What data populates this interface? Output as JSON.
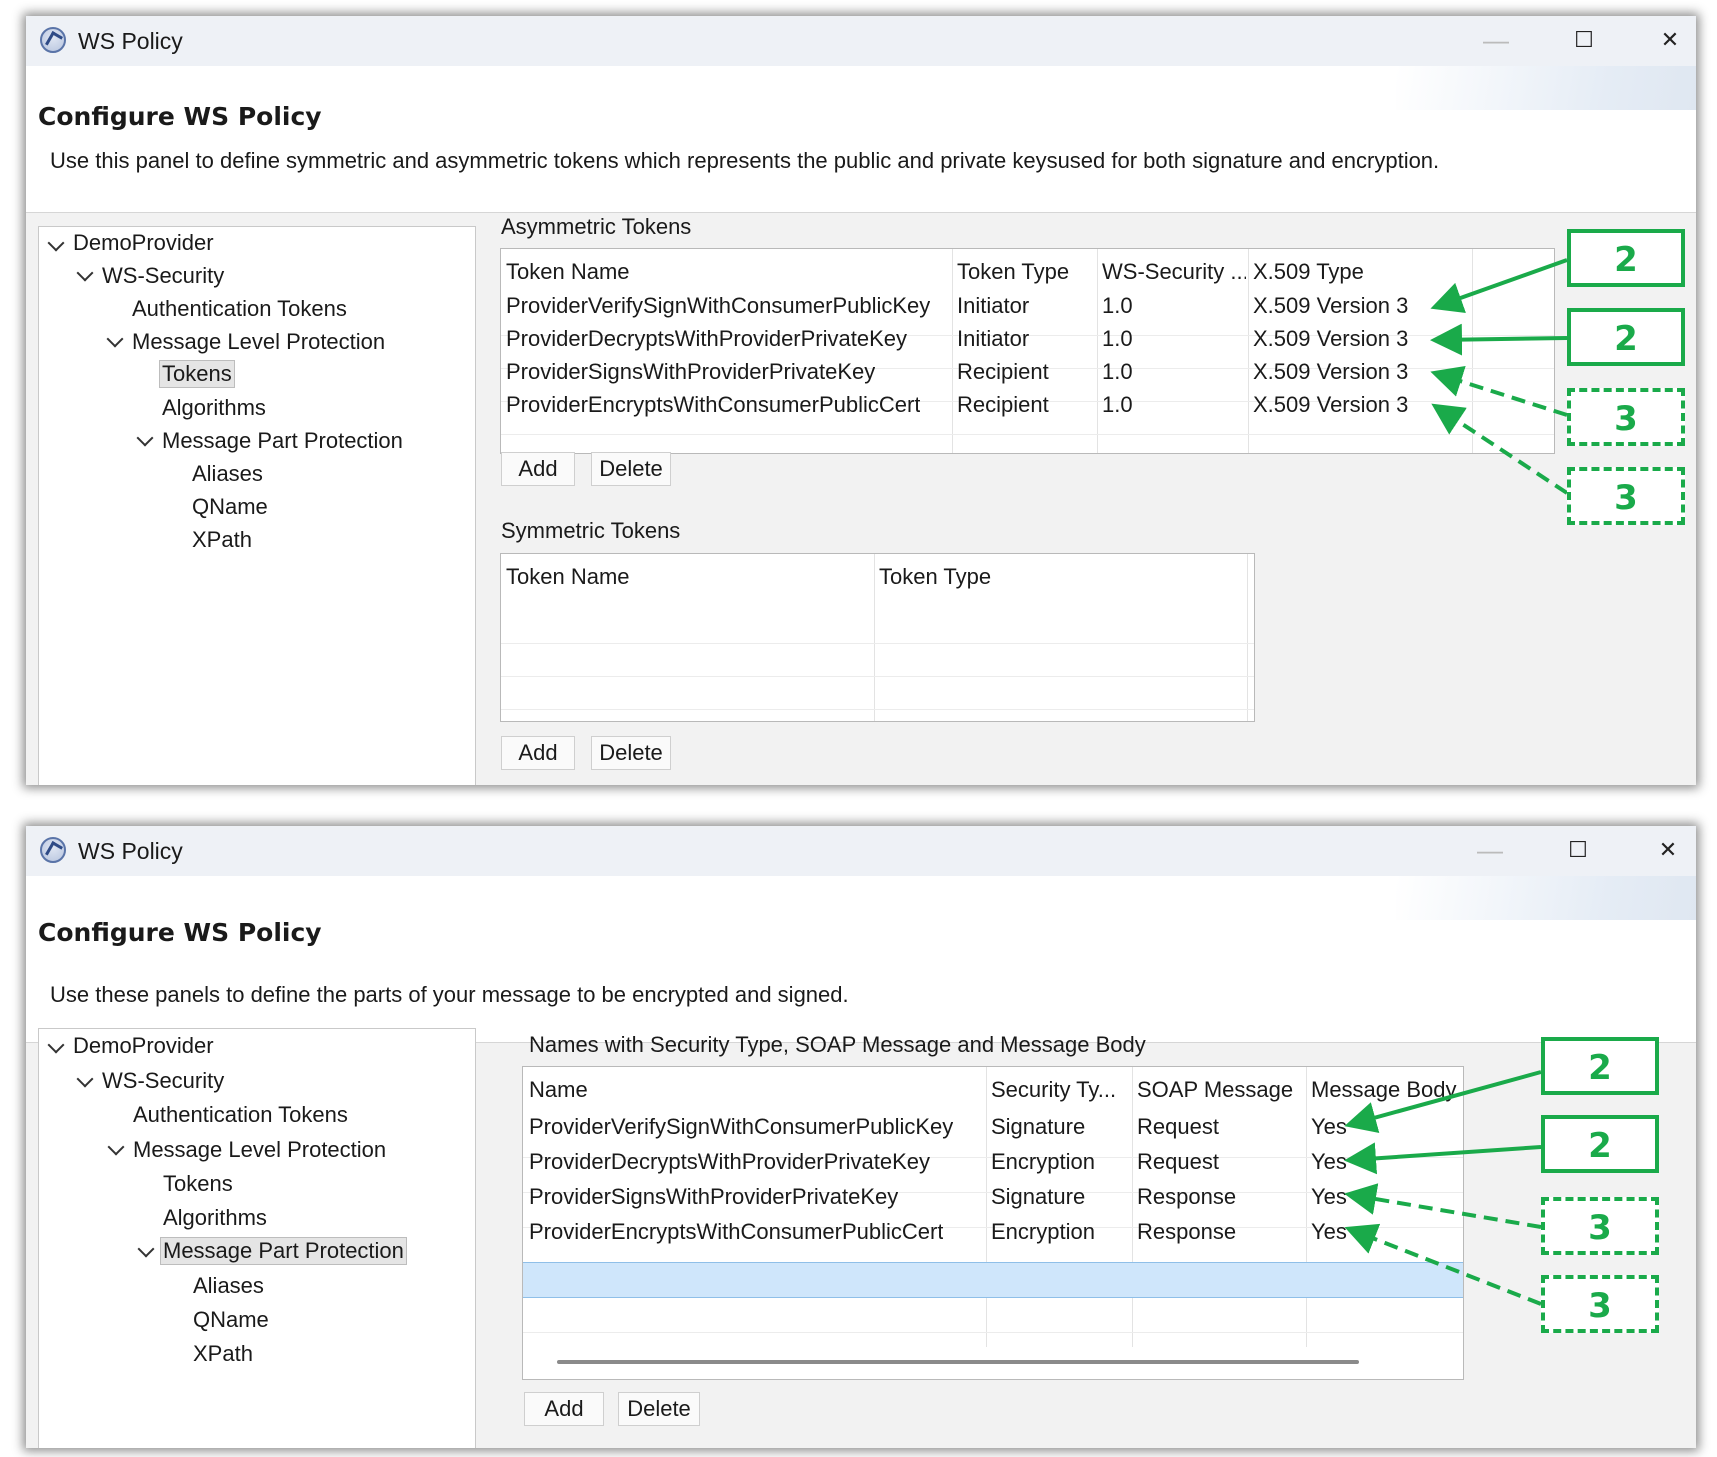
{
  "colors": {
    "accent_green": "#1aaa4a",
    "selection": "#cfe6fb"
  },
  "window1": {
    "title": "WS Policy",
    "controls": {
      "minimize": "—",
      "maximize": "☐",
      "close": "✕"
    },
    "page_title": "Configure WS Policy",
    "description": "Use this panel to define symmetric and asymmetric tokens which represents the public and private keysused for both signature and encryption.",
    "tree": {
      "root": "DemoProvider",
      "ws_security": "WS-Security",
      "auth_tokens": "Authentication Tokens",
      "mlp": "Message Level Protection",
      "tokens": "Tokens",
      "algorithms": "Algorithms",
      "mpp": "Message Part Protection",
      "aliases": "Aliases",
      "qname": "QName",
      "xpath": "XPath"
    },
    "asym": {
      "label": "Asymmetric Tokens",
      "columns": [
        "Token Name",
        "Token Type",
        "WS-Security ...",
        "X.509 Type"
      ],
      "rows": [
        [
          "ProviderVerifySignWithConsumerPublicKey",
          "Initiator",
          "1.0",
          "X.509 Version 3"
        ],
        [
          "ProviderDecryptsWithProviderPrivateKey",
          "Initiator",
          "1.0",
          "X.509 Version 3"
        ],
        [
          "ProviderSignsWithProviderPrivateKey",
          "Recipient",
          "1.0",
          "X.509 Version 3"
        ],
        [
          "ProviderEncryptsWithConsumerPublicCert",
          "Recipient",
          "1.0",
          "X.509 Version 3"
        ]
      ],
      "add": "Add",
      "delete": "Delete"
    },
    "sym": {
      "label": "Symmetric Tokens",
      "columns": [
        "Token Name",
        "Token Type"
      ],
      "add": "Add",
      "delete": "Delete"
    }
  },
  "window2": {
    "title": "WS Policy",
    "controls": {
      "minimize": "—",
      "maximize": "☐",
      "close": "✕"
    },
    "page_title": "Configure WS Policy",
    "description": "Use these panels to define the parts of your message to be encrypted and signed.",
    "tree": {
      "root": "DemoProvider",
      "ws_security": "WS-Security",
      "auth_tokens": "Authentication Tokens",
      "mlp": "Message Level Protection",
      "tokens": "Tokens",
      "algorithms": "Algorithms",
      "mpp": "Message Part Protection",
      "aliases": "Aliases",
      "qname": "QName",
      "xpath": "XPath"
    },
    "parts": {
      "label": "Names with Security Type, SOAP Message and Message Body",
      "columns": [
        "Name",
        "Security Ty...",
        "SOAP Message",
        "Message Body"
      ],
      "rows": [
        [
          "ProviderVerifySignWithConsumerPublicKey",
          "Signature",
          "Request",
          "Yes"
        ],
        [
          "ProviderDecryptsWithProviderPrivateKey",
          "Encryption",
          "Request",
          "Yes"
        ],
        [
          "ProviderSignsWithProviderPrivateKey",
          "Signature",
          "Response",
          "Yes"
        ],
        [
          "ProviderEncryptsWithConsumerPublicCert",
          "Encryption",
          "Response",
          "Yes"
        ]
      ],
      "add": "Add",
      "delete": "Delete"
    }
  },
  "annotations": {
    "top": [
      "2",
      "2",
      "3",
      "3"
    ],
    "bottom": [
      "2",
      "2",
      "3",
      "3"
    ]
  }
}
